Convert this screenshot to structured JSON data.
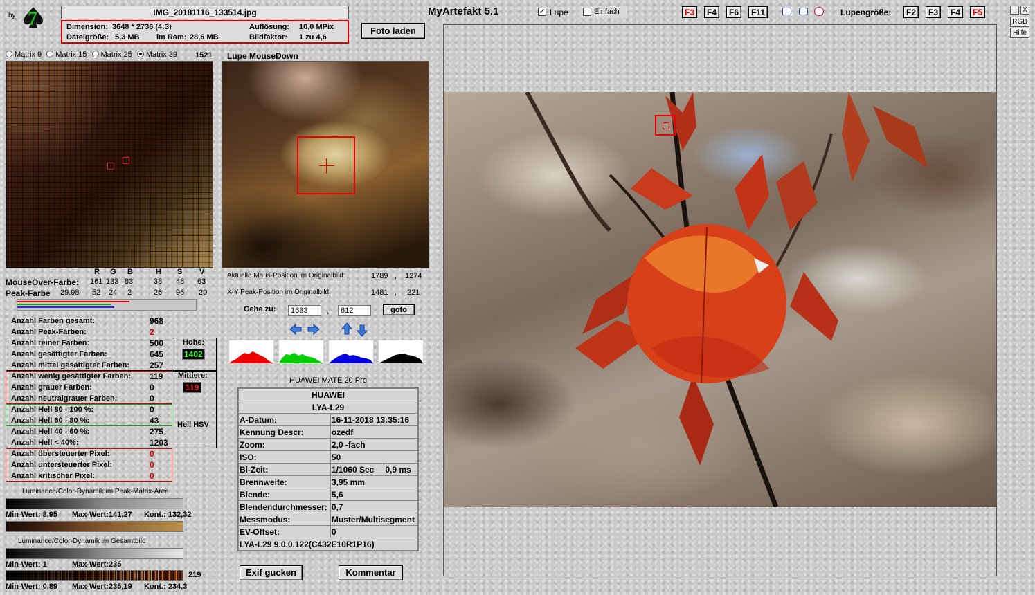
{
  "brand": {
    "by": "by",
    "logo_digit": "7"
  },
  "file": {
    "name": "IMG_20181116_133514.jpg",
    "dimension_label": "Dimension:",
    "dimension_value": "3648 * 2736 (4:3)",
    "resolution_label": "Auflösung:",
    "resolution_value": "10,0 MPix",
    "filesize_label": "Dateigröße:",
    "filesize_value": "5,3 MB",
    "ram_label": "im Ram:",
    "ram_value": "28,6 MB",
    "factor_label": "Bildfaktor:",
    "factor_value": "1 zu 4,6"
  },
  "load_button": "Foto laden",
  "app_title": "MyArtefakt 5.1",
  "options": {
    "lupe": "Lupe",
    "einfach": "Einfach"
  },
  "fkeys": [
    "F3",
    "F4",
    "F6",
    "F11"
  ],
  "lupe_size": {
    "label": "Lupengröße:",
    "keys": [
      "F2",
      "F3",
      "F4",
      "F5"
    ]
  },
  "window_buttons": {
    "min": "_",
    "close": "X",
    "rgb": "RGB",
    "help": "Hilfe"
  },
  "matrix_options": [
    {
      "label": "Matrix 9",
      "checked": false
    },
    {
      "label": "Matrix 15",
      "checked": false
    },
    {
      "label": "Matrix 25",
      "checked": false
    },
    {
      "label": "Matrix 39",
      "checked": true
    }
  ],
  "matrix_count": "1521",
  "lupe_title": "Lupe MouseDown",
  "colors": {
    "headers": [
      "R",
      "G",
      "B",
      "H",
      "S",
      "V"
    ],
    "mouseover": {
      "label": "MouseOver-Farbe:",
      "values": [
        "161",
        "133",
        "83",
        "38",
        "48",
        "63"
      ]
    },
    "peak": {
      "label": "Peak-Farbe",
      "first": "29,98",
      "values": [
        "52",
        "24",
        "2",
        "26",
        "96",
        "20"
      ]
    }
  },
  "stats": [
    {
      "label": "Anzahl Farben gesamt:",
      "value": "968",
      "red": false
    },
    {
      "label": "Anzahl Peak-Farben:",
      "value": "2",
      "red": true
    },
    {
      "label": "Anzahl reiner Farben:",
      "value": "500",
      "red": false
    },
    {
      "label": "Anzahl gesättigter Farben:",
      "value": "645",
      "red": false
    },
    {
      "label": "Anzahl mittel gesättigter Farben:",
      "value": "257",
      "red": false
    },
    {
      "label": "Anzahl wenig gesättigter Farben:",
      "value": "119",
      "red": false
    },
    {
      "label": "Anzahl grauer Farben:",
      "value": "0",
      "red": false
    },
    {
      "label": "Anzahl neutralgrauer Farben:",
      "value": "0",
      "red": false
    },
    {
      "label": "Anzahl Hell 80 - 100 %:",
      "value": "0",
      "red": false
    },
    {
      "label": "Anzahl Hell 60 - 80 %:",
      "value": "43",
      "red": false
    },
    {
      "label": "Anzahl Hell 40 - 60 %:",
      "value": "275",
      "red": false
    },
    {
      "label": "Anzahl Hell < 40%:",
      "value": "1203",
      "red": false
    },
    {
      "label": "Anzahl übersteuerter Pixel:",
      "value": "0",
      "red": true
    },
    {
      "label": "Anzahl untersteuerter Pixel:",
      "value": "0",
      "red": true
    },
    {
      "label": "Anzahl kritischer Pixel:",
      "value": "0",
      "red": true
    }
  ],
  "side": {
    "hohe_label": "Hohe:",
    "hohe_value": "1402",
    "mittlere_label": "Mittlere:",
    "mittlere_value": "119",
    "hell_label": "Hell HSV"
  },
  "dynamics": {
    "peak_title": "Luminance/Color-Dynamik im Peak-Matrix-Area",
    "peak_min": "Min-Wert: 8,95",
    "peak_max": "Max-Wert:141,27",
    "peak_kont": "Kont.: 132,32",
    "total_title": "Luminance/Color-Dynamik im Gesamtbild",
    "total_min": "Min-Wert: 1",
    "total_max": "Max-Wert:235",
    "count": "219",
    "total2_min": "Min-Wert: 0,89",
    "total2_max": "Max-Wert:235,19",
    "total2_kont": "Kont.: 234,3"
  },
  "positions": {
    "mouse_label": "Aktuelle Maus-Position  im Originalbild:",
    "mouse_x": "1789",
    "mouse_y": "1274",
    "peak_label": "X-Y Peak-Position  im Originalbild:",
    "peak_x": "1481",
    "peak_y": "221",
    "sep": ","
  },
  "goto": {
    "label": "Gehe zu:",
    "x": "1633",
    "sep": ",",
    "y": "612",
    "button": "goto"
  },
  "device": "HUAWEI MATE 20 Pro",
  "exif": {
    "make": "HUAWEI",
    "model": "LYA-L29",
    "date_label": "A-Datum:",
    "date_value": "16-11-2018 13:35:16",
    "kennung_label": "Kennung Descr:",
    "kennung_value": "ozedf",
    "zoom_label": "Zoom:",
    "zoom_value": "2,0 -fach",
    "iso_label": "ISO:",
    "iso_value": "50",
    "bl_label": "Bl-Zeit:",
    "bl_value1": "1/1060 Sec",
    "bl_value2": "0,9 ms",
    "focal_label": "Brennweite:",
    "focal_value": "3,95  mm",
    "aperture_label": "Blende:",
    "aperture_value": "5,6",
    "diam_label": "Blendendurchmesser:",
    "diam_value": "0,7",
    "mess_label": "Messmodus:",
    "mess_value": "Muster/Multisegment",
    "ev_label": "EV-Offset:",
    "ev_value": "0",
    "firmware": "LYA-L29 9.0.0.122(C432E10R1P16)"
  },
  "buttons": {
    "exif": "Exif gucken",
    "comment": "Kommentar"
  },
  "palette": {
    "red": "#d40000",
    "green": "#18a018",
    "accent": "#1a3c9a"
  }
}
